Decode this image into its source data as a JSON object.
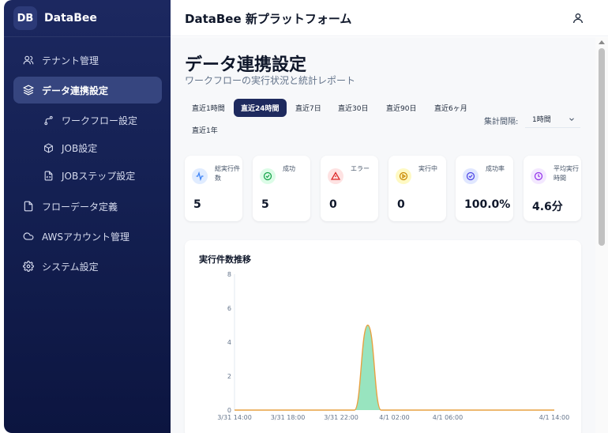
{
  "brand": {
    "logo": "DB",
    "name": "DataBee"
  },
  "header": {
    "title": "DataBee 新プラットフォーム",
    "user_icon": "user-icon"
  },
  "sidebar": {
    "items": [
      {
        "label": "テナント管理",
        "icon": "users-icon"
      },
      {
        "label": "データ連携設定",
        "icon": "layers-icon",
        "active": true
      },
      {
        "label": "ワークフロー設定",
        "icon": "workflow-icon",
        "sub": true
      },
      {
        "label": "JOB設定",
        "icon": "cube-icon",
        "sub": true
      },
      {
        "label": "JOBステップ設定",
        "icon": "file-code-icon",
        "sub": true
      },
      {
        "label": "フローデータ定義",
        "icon": "file-icon"
      },
      {
        "label": "AWSアカウント管理",
        "icon": "cloud-icon"
      },
      {
        "label": "システム設定",
        "icon": "gear-icon"
      }
    ]
  },
  "page": {
    "title": "データ連携設定",
    "subtitle": "ワークフローの実行状況と統計レポート"
  },
  "ranges": {
    "items": [
      "直近1時間",
      "直近24時間",
      "直近7日",
      "直近30日",
      "直近90日",
      "直近6ヶ月",
      "直近1年"
    ],
    "selected": "直近24時間"
  },
  "interval": {
    "label": "集計間隔:",
    "value": "1時間"
  },
  "stats": [
    {
      "label": "総実行件数",
      "value": "5",
      "icon": "activity-icon",
      "color": "#3b82f6",
      "bg": "#e0ecff"
    },
    {
      "label": "成功",
      "value": "5",
      "icon": "check-circle-icon",
      "color": "#16a34a",
      "bg": "#dcfce7"
    },
    {
      "label": "エラー",
      "value": "0",
      "icon": "alert-triangle-icon",
      "color": "#dc2626",
      "bg": "#fee2e2"
    },
    {
      "label": "実行中",
      "value": "0",
      "icon": "play-circle-icon",
      "color": "#ca8a04",
      "bg": "#fef9c3"
    },
    {
      "label": "成功率",
      "value": "100.0%",
      "icon": "badge-check-icon",
      "color": "#4f46e5",
      "bg": "#e0e7ff"
    },
    {
      "label": "平均実行時間",
      "value": "4.6分",
      "icon": "clock-icon",
      "color": "#9333ea",
      "bg": "#f3e8ff"
    }
  ],
  "chart_data": {
    "type": "area",
    "title": "実行件数推移",
    "xlabel": "",
    "ylabel": "",
    "ylim": [
      0,
      8
    ],
    "yticks": [
      0,
      2,
      4,
      6,
      8
    ],
    "xticks": [
      "3/31 14:00",
      "3/31 18:00",
      "3/31 22:00",
      "4/1 02:00",
      "4/1 06:00",
      "4/1 14:00"
    ],
    "x": [
      "3/31 14:00",
      "3/31 15:00",
      "3/31 16:00",
      "3/31 17:00",
      "3/31 18:00",
      "3/31 19:00",
      "3/31 20:00",
      "3/31 21:00",
      "3/31 22:00",
      "3/31 23:00",
      "4/1 00:00",
      "4/1 01:00",
      "4/1 02:00",
      "4/1 03:00",
      "4/1 04:00",
      "4/1 05:00",
      "4/1 06:00",
      "4/1 07:00",
      "4/1 08:00",
      "4/1 09:00",
      "4/1 10:00",
      "4/1 11:00",
      "4/1 12:00",
      "4/1 13:00",
      "4/1 14:00"
    ],
    "series": [
      {
        "values": [
          0,
          0,
          0,
          0,
          0,
          0,
          0,
          0,
          0,
          0,
          5,
          0,
          0,
          0,
          0,
          0,
          0,
          0,
          0,
          0,
          0,
          0,
          0,
          0,
          0
        ],
        "stroke": "#e8a040",
        "fill": "#86dfb4"
      }
    ]
  }
}
